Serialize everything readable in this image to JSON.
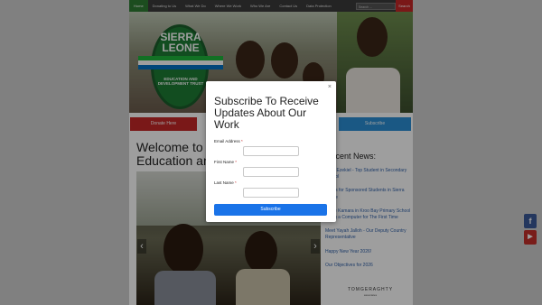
{
  "nav": {
    "items": [
      "Home",
      "Donating to Us",
      "What We Do",
      "Where We Work",
      "Who We Are",
      "Contact Us",
      "Data Protection"
    ],
    "search_placeholder": "Search ...",
    "search_button": "Search"
  },
  "logo": {
    "line1": "SIERRA",
    "line2": "LEONE",
    "sub": "EDUCATION AND DEVELOPMENT TRUST"
  },
  "buttons": {
    "donate": "Donate Here",
    "subscribe": "Subscribe"
  },
  "main": {
    "welcome_line1": "Welcome to S",
    "welcome_line2": "Education an"
  },
  "sidebar": {
    "heading": "Recent News:",
    "items": [
      "Meet Ezekiel - Top Student in Secondary School",
      "Pupils for Sponsored Students in Sierra Leone",
      "Annie Kamara in Kroo Bay Primary School Using a Computer for The First Time",
      "Meet Yayah Jalloh - Our Deputy Country Representative",
      "Happy New Year 2026!",
      "Our Objectives for 2026"
    ]
  },
  "partner": {
    "name": "TOMGERAGHTY",
    "sub": "associates"
  },
  "modal": {
    "close": "×",
    "title": "Subscribe To Receive Updates About Our Work",
    "fields": [
      {
        "label": "Email Address",
        "required": "*"
      },
      {
        "label": "First Name",
        "required": "*"
      },
      {
        "label": "Last Name",
        "required": "*"
      }
    ],
    "submit": "Subscribe"
  },
  "social": {
    "facebook": "f",
    "youtube": "▶"
  },
  "colors": {
    "nav_bg": "#3b3b3b",
    "nav_active": "#2e7d32",
    "donate": "#c62828",
    "subscribe_button": "#1a73e8",
    "sidebar_subscribe": "#2a8fd6",
    "link": "#2e5fa8"
  }
}
